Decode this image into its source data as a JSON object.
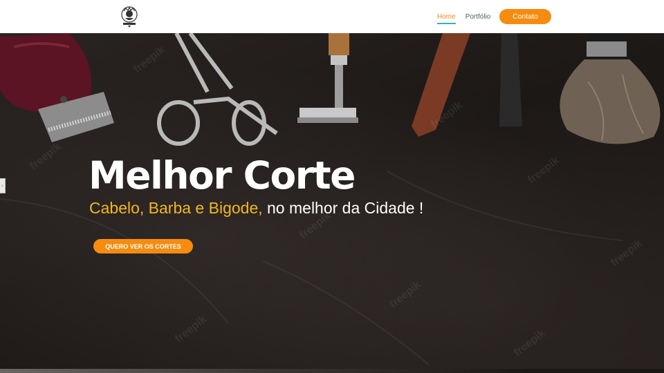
{
  "header": {
    "logo": "barbershop-logo",
    "nav": [
      {
        "label": "Home",
        "active": true
      },
      {
        "label": "Portfólio",
        "active": false
      }
    ],
    "contact_label": "Contato"
  },
  "hero": {
    "title": "Melhor Corte",
    "subtitle_highlight": "Cabelo, Barba e Bigode,",
    "subtitle_rest": " no melhor da Cidade !",
    "cta_label": "QUERO VER OS CORTES",
    "watermark_text": "freepik"
  },
  "colors": {
    "accent": "#f58c10",
    "highlight": "#f4b81c",
    "nav_active_underline": "#2fb7a8",
    "background": "#1c1816"
  },
  "icons": [
    "hair-clipper-icon",
    "scissors-icon",
    "safety-razor-icon",
    "straight-razor-icon",
    "comb-icon",
    "shaving-brush-icon"
  ]
}
